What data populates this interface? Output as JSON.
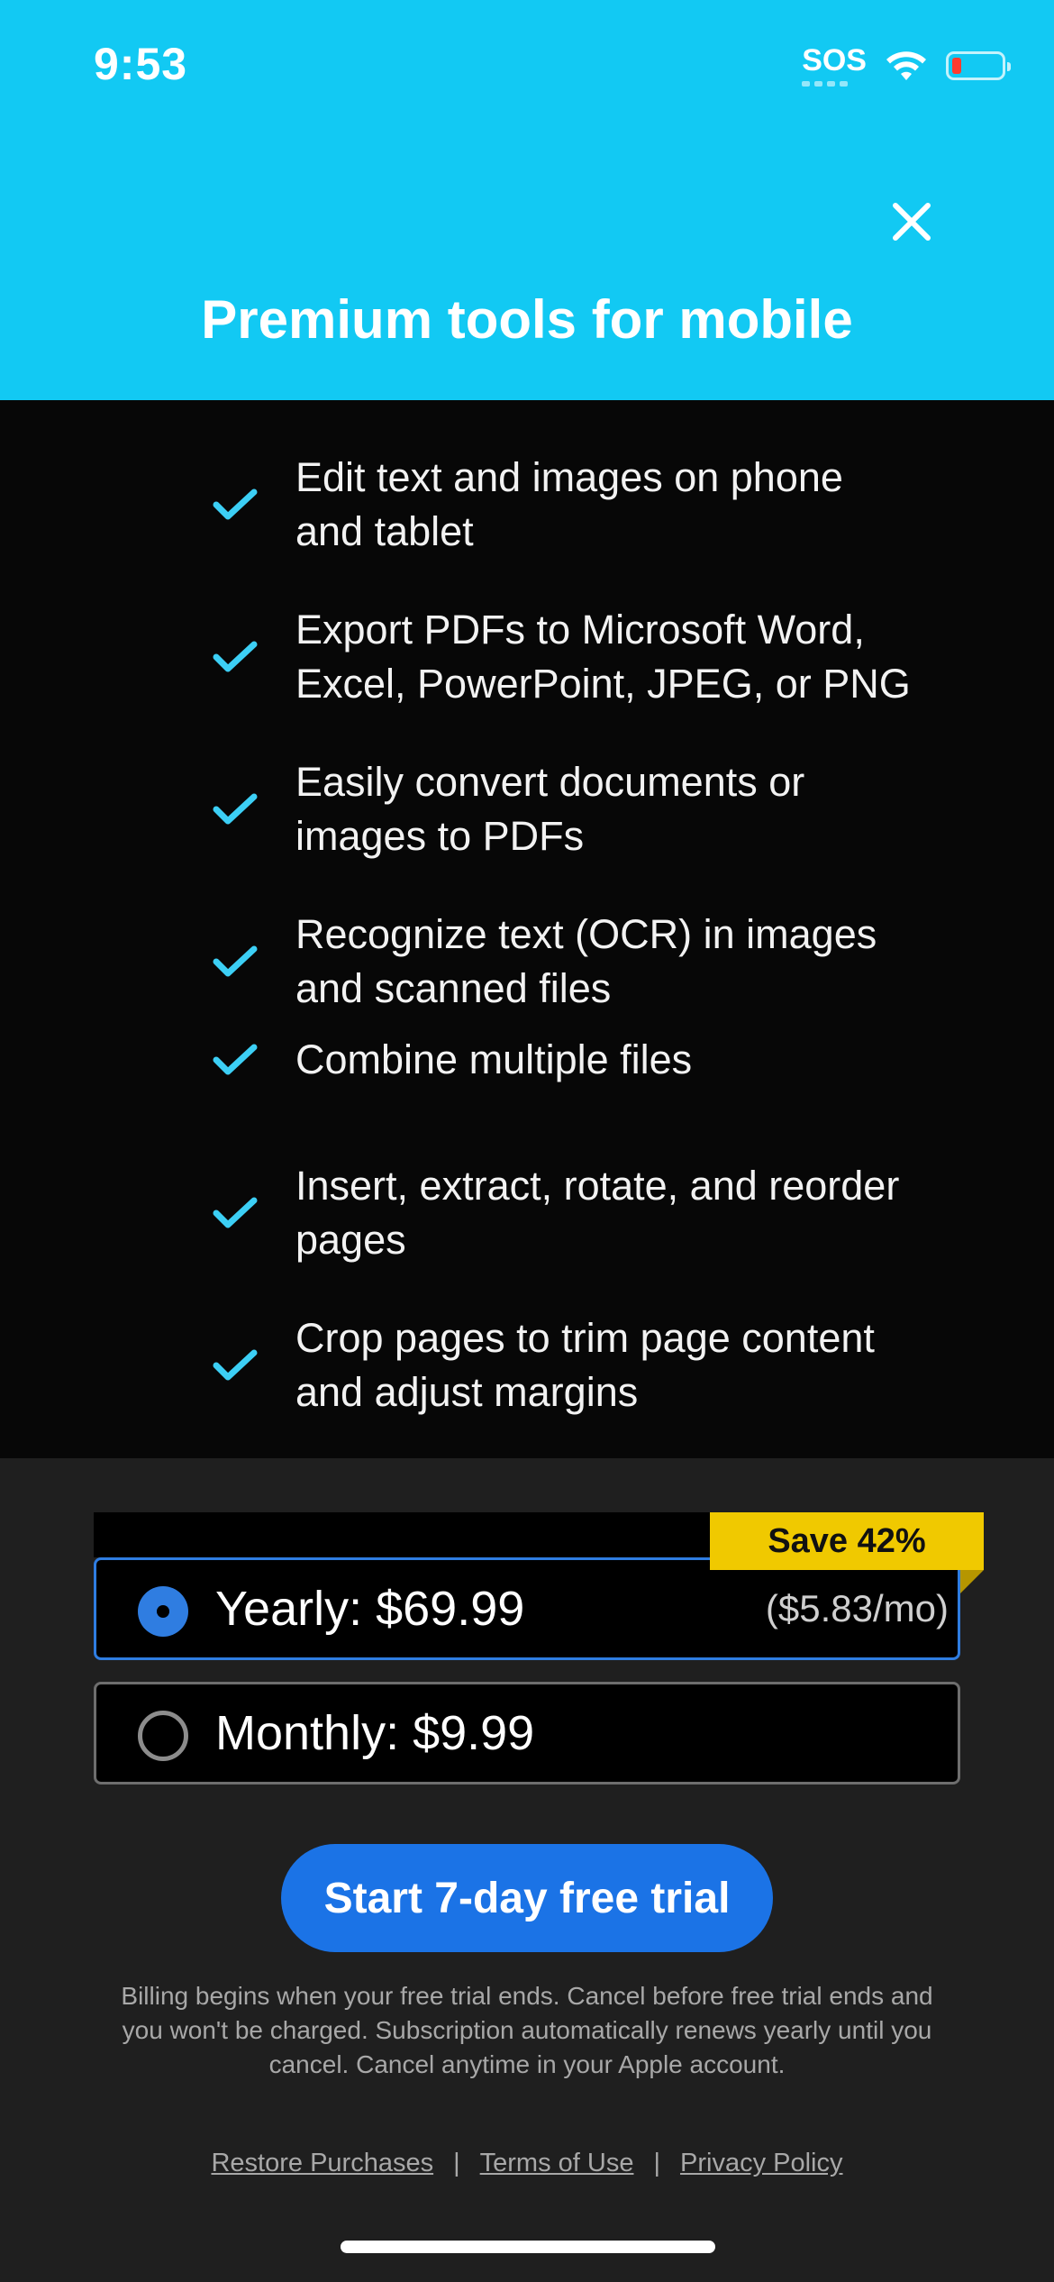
{
  "status_bar": {
    "time": "9:53",
    "sos": "SOS"
  },
  "header": {
    "title": "Premium tools for mobile",
    "close_icon": "close-icon"
  },
  "features": [
    "Edit text and images on phone and tablet",
    "Export PDFs to Microsoft Word, Excel, PowerPoint, JPEG, or PNG",
    "Easily convert documents or images to PDFs",
    "Recognize text (OCR) in images and scanned files",
    "Combine multiple files",
    "Insert, extract, rotate, and reorder pages",
    "Crop pages to trim page content and adjust margins"
  ],
  "plans": {
    "badge": "Save 42%",
    "yearly": {
      "label": "Yearly: $69.99",
      "per_month": "($5.83/mo)",
      "selected": true
    },
    "monthly": {
      "label": "Monthly: $9.99",
      "selected": false
    }
  },
  "cta": {
    "label": "Start 7-day free trial"
  },
  "billing_text": "Billing begins when your free trial ends. Cancel before free trial ends and you won't be charged. Subscription automatically renews yearly until you cancel. Cancel anytime in your Apple account.",
  "footer": {
    "restore": "Restore Purchases",
    "terms": "Terms of Use",
    "privacy": "Privacy Policy",
    "separator": "|"
  },
  "colors": {
    "header_bg": "#12c9f3",
    "accent_blue": "#1b73e6",
    "check": "#3ccff5",
    "badge": "#f0c900"
  }
}
